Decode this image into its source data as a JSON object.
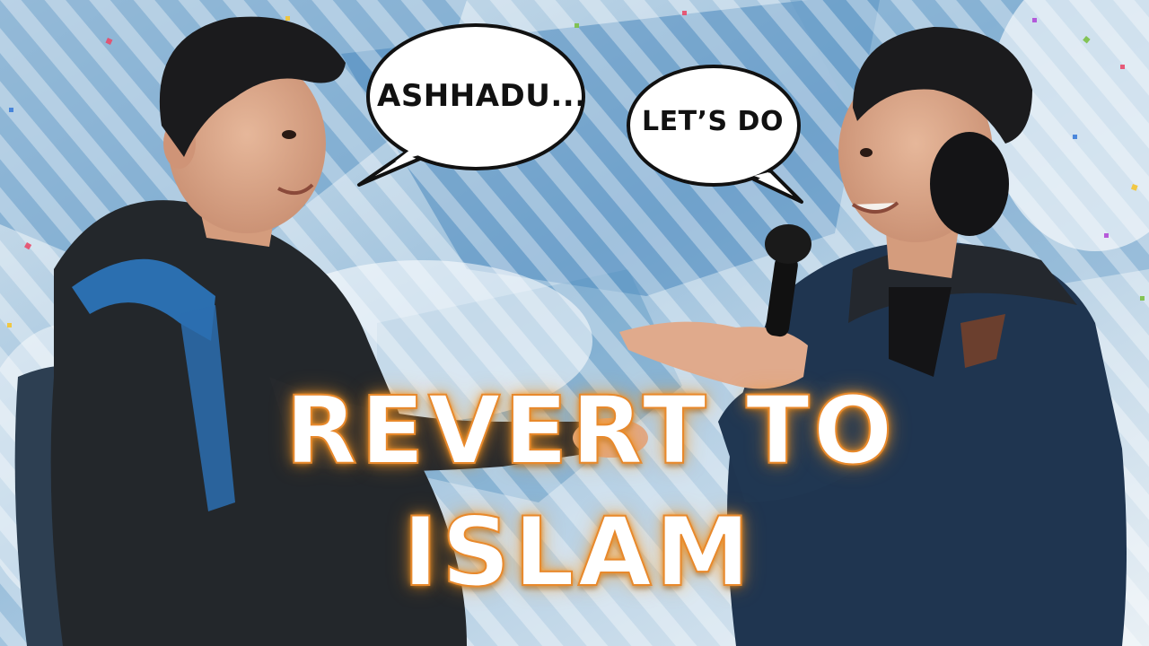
{
  "speech_bubbles": {
    "left_text": "ASHHADU...",
    "right_text": "LET’S DO"
  },
  "headline": {
    "line1": "REVERT TO",
    "line2": "ISLAM",
    "glow_color": "#f39628",
    "text_color": "#ffffff"
  },
  "colors": {
    "background_blue": "#4f8fc2",
    "background_light": "#e6eef4",
    "jacket_dark": "#23272b",
    "jacket_right": "#1f3550",
    "backpack_strap": "#2b6fb0"
  }
}
